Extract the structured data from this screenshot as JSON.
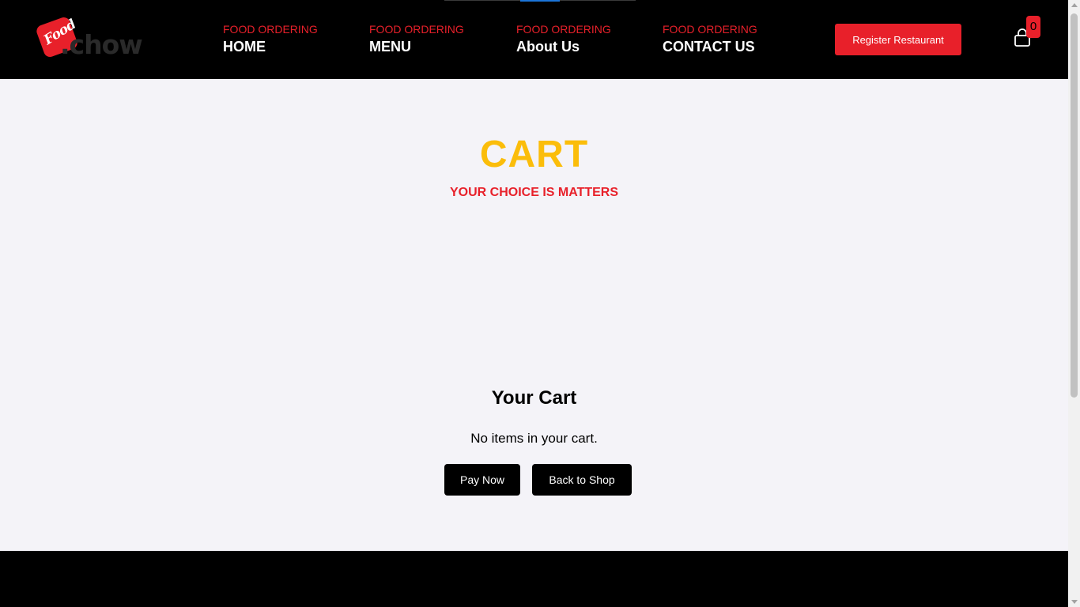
{
  "header": {
    "logo": {
      "badge_text": "Food",
      "word": ".chow"
    },
    "nav": [
      {
        "kicker": "FOOD ORDERING",
        "label": "HOME"
      },
      {
        "kicker": "FOOD ORDERING",
        "label": "MENU"
      },
      {
        "kicker": "FOOD ORDERING",
        "label": "About Us"
      },
      {
        "kicker": "FOOD ORDERING",
        "label": "CONTACT US"
      }
    ],
    "register_label": "Register Restaurant",
    "cart_count": "0",
    "cart_icon": "shopping-bag-icon"
  },
  "main": {
    "title": "CART",
    "subtitle": "YOUR CHOICE IS MATTERS",
    "cart_heading": "Your Cart",
    "empty_message": "No items in your cart.",
    "pay_label": "Pay Now",
    "back_label": "Back to Shop"
  },
  "colors": {
    "brand_red": "#e8202a",
    "title_yellow": "#fbbd0a",
    "header_bg": "#000000",
    "page_bg": "#f4f3f8"
  }
}
